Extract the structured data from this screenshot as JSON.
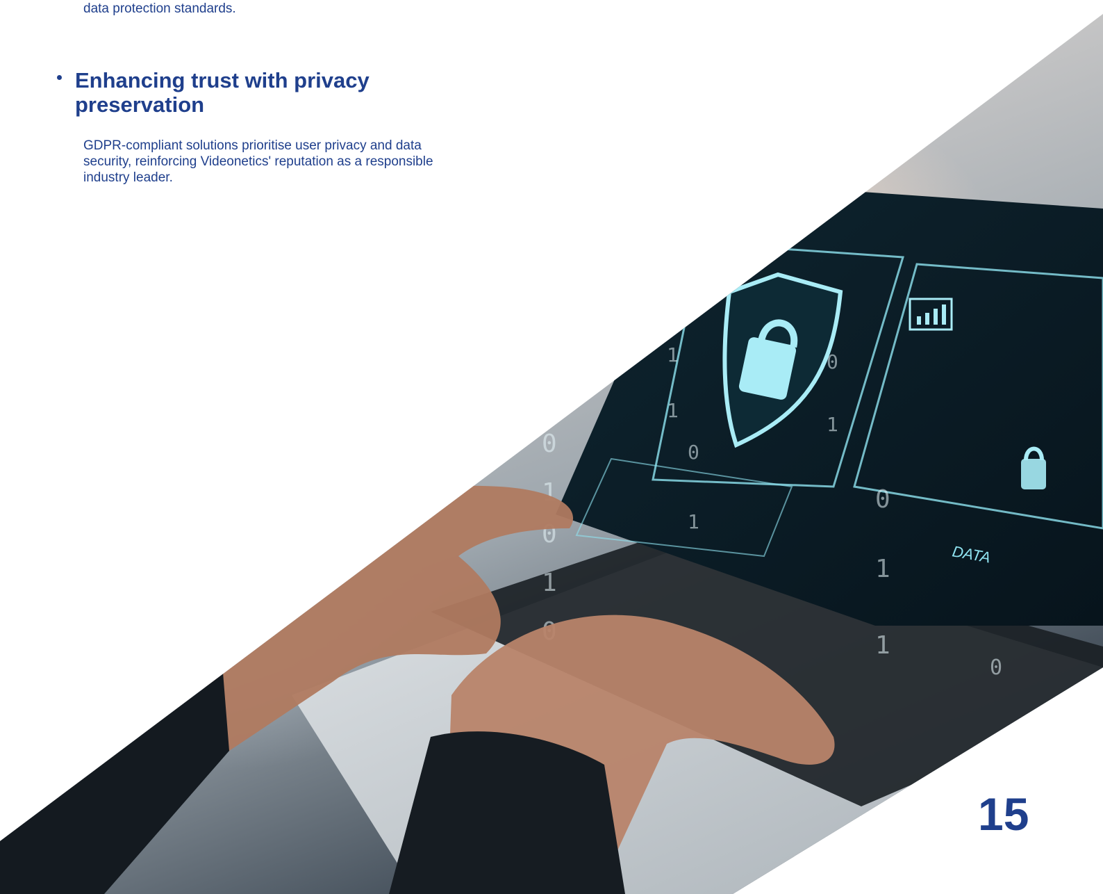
{
  "intro": {
    "trailing_text": "data protection standards."
  },
  "section": {
    "heading": "Enhancing trust with privacy preservation",
    "body": "GDPR-compliant solutions prioritise user privacy and data security, reinforcing Videonetics' reputation as a responsible industry leader."
  },
  "photo": {
    "screen_label": "DATA"
  },
  "footer": {
    "page_number": "15"
  },
  "colors": {
    "text_blue": "#1f3f8c",
    "screen_accent": "#8fe3f0"
  }
}
